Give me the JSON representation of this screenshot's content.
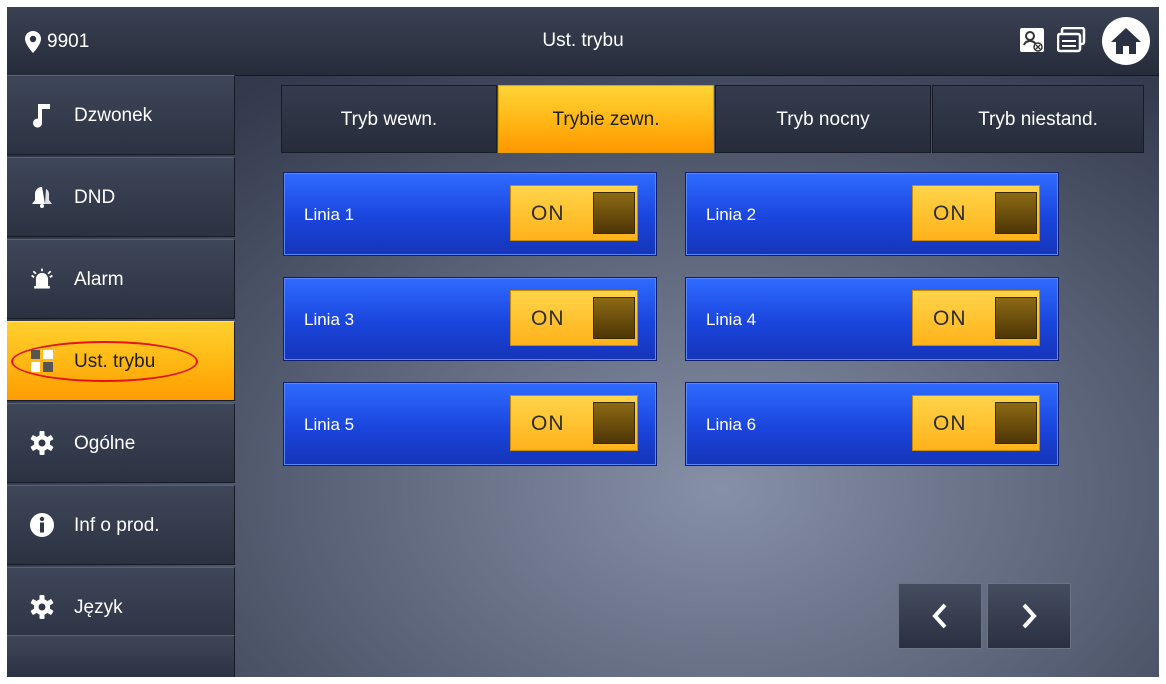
{
  "header": {
    "location": "9901",
    "title": "Ust. trybu",
    "icons": [
      "location-pin-icon",
      "contact-status-icon",
      "message-icon",
      "home-icon"
    ]
  },
  "sidebar": {
    "items": [
      {
        "label": "Dzwonek",
        "icon": "music-note-icon"
      },
      {
        "label": "DND",
        "icon": "bell-icon"
      },
      {
        "label": "Alarm",
        "icon": "siren-icon"
      },
      {
        "label": "Ust. trybu",
        "icon": "grid-icon",
        "active": true
      },
      {
        "label": "Ogólne",
        "icon": "gear-icon"
      },
      {
        "label": "Inf o prod.",
        "icon": "info-icon"
      },
      {
        "label": "Język",
        "icon": "gear-icon"
      }
    ]
  },
  "tabs": [
    {
      "label": "Tryb wewn.",
      "active": false
    },
    {
      "label": "Trybie zewn.",
      "active": true
    },
    {
      "label": "Tryb nocny",
      "active": false
    },
    {
      "label": "Tryb niestand.",
      "active": false
    }
  ],
  "lines": [
    {
      "label": "Linia 1",
      "state": "ON"
    },
    {
      "label": "Linia 2",
      "state": "ON"
    },
    {
      "label": "Linia 3",
      "state": "ON"
    },
    {
      "label": "Linia 4",
      "state": "ON"
    },
    {
      "label": "Linia 5",
      "state": "ON"
    },
    {
      "label": "Linia 6",
      "state": "ON"
    }
  ],
  "pager": {
    "prev_icon": "chevron-left-icon",
    "next_icon": "chevron-right-icon"
  },
  "colors": {
    "accent": "#ffb612",
    "line_blue": "#1a45dd",
    "annotation": "#e31414"
  }
}
